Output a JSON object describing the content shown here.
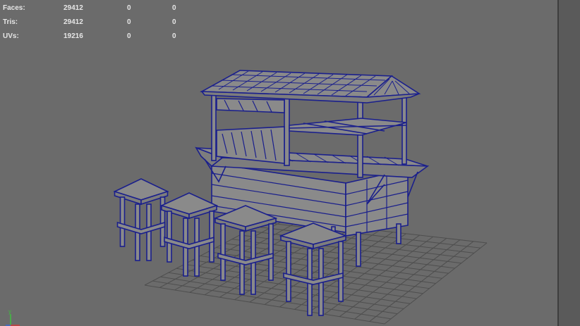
{
  "hud": {
    "rows": [
      {
        "label": "Faces:",
        "v1": "29412",
        "v2": "0",
        "v3": "0"
      },
      {
        "label": "Tris:",
        "v1": "29412",
        "v2": "0",
        "v3": "0"
      },
      {
        "label": "UVs:",
        "v1": "19216",
        "v2": "0",
        "v3": "0"
      }
    ]
  },
  "axis": {
    "y_label": "y",
    "colors": {
      "x": "#d23b3b",
      "y": "#3fbf3f",
      "z": "#3b6bd2"
    }
  },
  "colors": {
    "viewport_bg": "#6b6b6b",
    "wireframe": "#1a1f8c",
    "mesh_fill": "#8a8a8a",
    "grid": "#4e4e4e"
  },
  "model": "wireframe bar counter with roof and four stools"
}
